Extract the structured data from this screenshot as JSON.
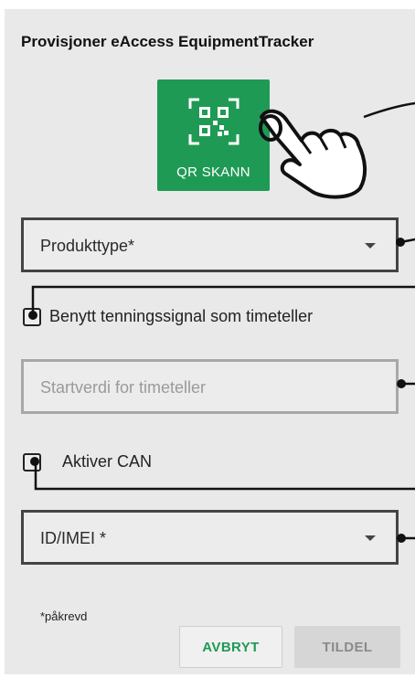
{
  "dialog": {
    "title": "Provisjoner eAccess EquipmentTracker"
  },
  "qr": {
    "label": "QR SKANN",
    "color": "#1f9a55"
  },
  "fields": {
    "product_type": {
      "placeholder": "Produkttype*"
    },
    "start_value": {
      "placeholder": "Startverdi for timeteller"
    },
    "id_imei": {
      "placeholder": "ID/IMEI *"
    }
  },
  "checkboxes": {
    "ignition": {
      "label": "Benytt tenningssignal som timeteller"
    },
    "can": {
      "label": "Aktiver CAN"
    }
  },
  "required_note": "*påkrevd",
  "buttons": {
    "cancel": "AVBRYT",
    "assign": "TILDEL"
  }
}
